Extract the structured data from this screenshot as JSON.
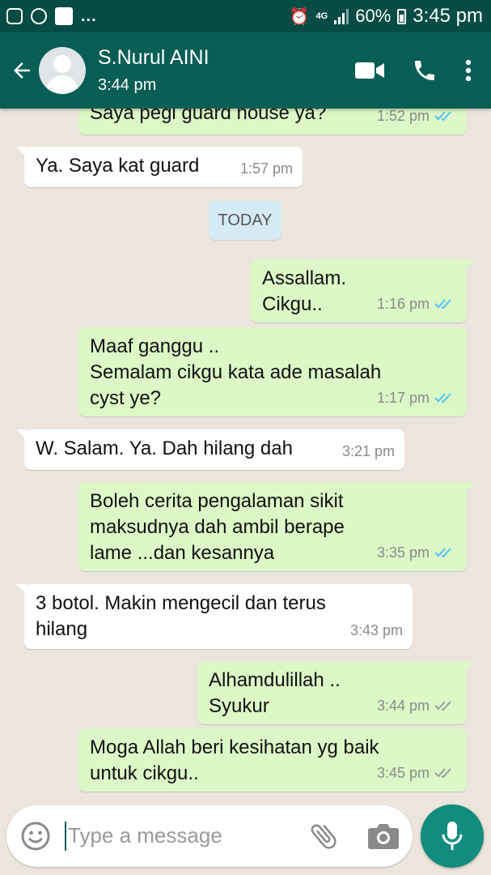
{
  "status_bar": {
    "battery": "60%",
    "time": "3:45 pm",
    "network": "4G",
    "overflow": "..."
  },
  "header": {
    "contact_name": "S.Nurul AINI",
    "subtitle": "3:44 pm"
  },
  "date_separator": "TODAY",
  "messages": [
    {
      "direction": "out",
      "text": "Saya pegi guard house ya?",
      "time": "1:52 pm",
      "status": "read"
    },
    {
      "direction": "in",
      "text": "Ya. Saya kat guard",
      "time": "1:57 pm"
    },
    {
      "direction": "out",
      "text": "Assallam.\nCikgu..",
      "time": "1:16 pm",
      "status": "read"
    },
    {
      "direction": "out",
      "text": "Maaf ganggu ..\nSemalam cikgu kata ade masalah\ncyst ye?",
      "time": "1:17 pm",
      "status": "read"
    },
    {
      "direction": "in",
      "text": "W. Salam. Ya. Dah hilang dah",
      "time": "3:21 pm"
    },
    {
      "direction": "out",
      "text": "Boleh cerita pengalaman sikit\nmaksudnya dah ambil berape\nlame ...dan kesannya",
      "time": "3:35 pm",
      "status": "read"
    },
    {
      "direction": "in",
      "text": "3 botol. Makin mengecil dan terus\nhilang",
      "time": "3:43 pm"
    },
    {
      "direction": "out",
      "text": "Alhamdulillah ..\nSyukur",
      "time": "3:44 pm",
      "status": "delivered"
    },
    {
      "direction": "out",
      "text": "Moga Allah beri kesihatan yg baik\nuntuk cikgu..",
      "time": "3:45 pm",
      "status": "delivered"
    }
  ],
  "composer": {
    "placeholder": "Type a message"
  },
  "colors": {
    "header": "#075E54",
    "statusbar": "#054C44",
    "outgoing": "#DCF8C6",
    "incoming": "#FFFFFF",
    "background": "#ECE5DD",
    "read_tick": "#4FC3F7",
    "delivered_tick": "#9E9E9E",
    "mic": "#128C7E"
  },
  "icons": {
    "back": "arrow-left-icon",
    "video": "video-camera-icon",
    "call": "phone-icon",
    "menu": "more-vertical-icon",
    "emoji": "emoji-icon",
    "attach": "paperclip-icon",
    "camera": "camera-icon",
    "mic": "microphone-icon"
  }
}
